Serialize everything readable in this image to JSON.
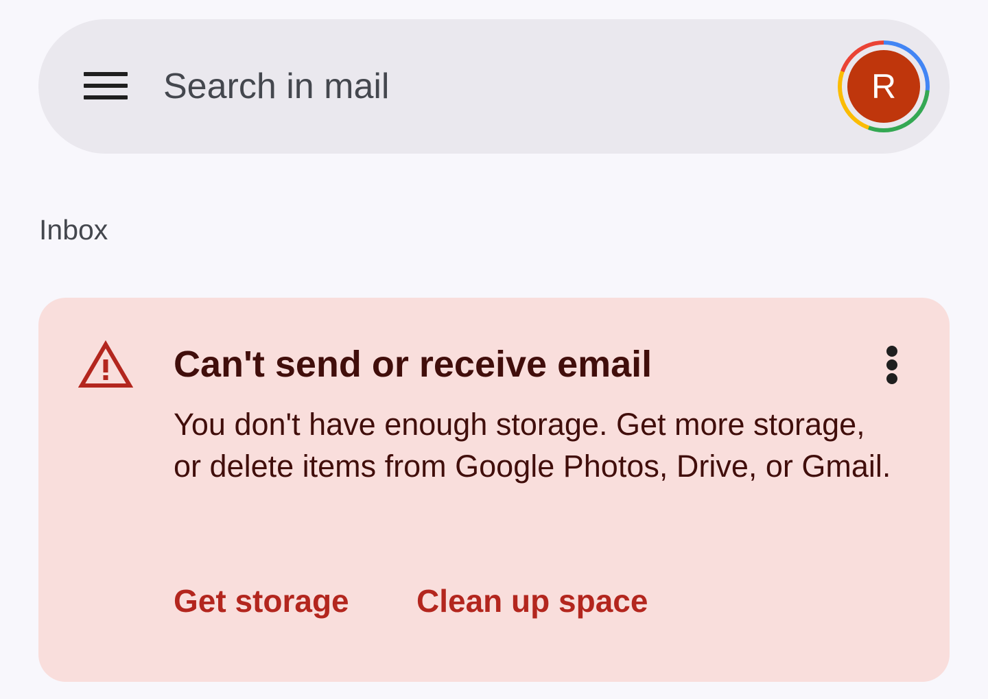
{
  "search": {
    "placeholder": "Search in mail"
  },
  "account": {
    "avatar_initial": "R",
    "avatar_color": "#bf360c"
  },
  "icons": {
    "menu": "hamburger-menu-icon",
    "warning": "warning-triangle-icon",
    "more": "more-vert-icon"
  },
  "inbox": {
    "label": "Inbox"
  },
  "alert": {
    "title": "Can't send or receive email",
    "body": "You don't have enough storage. Get more storage, or delete items from Google Photos, Drive, or Gmail.",
    "primary_action": "Get storage",
    "secondary_action": "Clean up space",
    "background_color": "#f9dedc",
    "accent_color": "#b3261e"
  }
}
